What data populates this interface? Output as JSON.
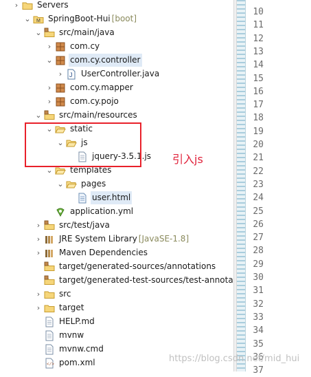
{
  "tree": {
    "items": [
      {
        "label": "Servers",
        "icon": "folder-icon",
        "twisty": "collapsed"
      },
      {
        "label": "SpringBoot-Hui",
        "decoration": "[boot]",
        "icon": "maven-project-icon",
        "twisty": "expanded"
      },
      {
        "label": "src/main/java",
        "icon": "source-folder-icon",
        "twisty": "expanded"
      },
      {
        "label": "com.cy",
        "icon": "package-icon",
        "twisty": "collapsed"
      },
      {
        "label": "com.cy.controller",
        "icon": "package-icon",
        "twisty": "expanded",
        "selected": true
      },
      {
        "label": "UserController.java",
        "icon": "java-file-icon",
        "twisty": "collapsed"
      },
      {
        "label": "com.cy.mapper",
        "icon": "package-icon",
        "twisty": "collapsed"
      },
      {
        "label": "com.cy.pojo",
        "icon": "package-icon",
        "twisty": "collapsed"
      },
      {
        "label": "src/main/resources",
        "icon": "source-folder-icon",
        "twisty": "expanded"
      },
      {
        "label": "static",
        "icon": "folder-open-icon",
        "twisty": "expanded"
      },
      {
        "label": "js",
        "icon": "folder-open-icon",
        "twisty": "expanded"
      },
      {
        "label": "jquery-3.5.1.js",
        "icon": "file-icon",
        "twisty": "none"
      },
      {
        "label": "templates",
        "icon": "folder-open-icon",
        "twisty": "expanded"
      },
      {
        "label": "pages",
        "icon": "folder-open-icon",
        "twisty": "expanded"
      },
      {
        "label": "user.html",
        "icon": "html-file-icon",
        "twisty": "none",
        "selected": true
      },
      {
        "label": "application.yml",
        "icon": "yml-file-icon",
        "twisty": "none"
      },
      {
        "label": "src/test/java",
        "icon": "source-folder-icon",
        "twisty": "collapsed"
      },
      {
        "label": "JRE System Library",
        "decoration": "[JavaSE-1.8]",
        "icon": "library-icon",
        "twisty": "collapsed"
      },
      {
        "label": "Maven Dependencies",
        "icon": "library-icon",
        "twisty": "collapsed"
      },
      {
        "label": "target/generated-sources/annotations",
        "icon": "source-folder-icon",
        "twisty": "none"
      },
      {
        "label": "target/generated-test-sources/test-annotation",
        "icon": "source-folder-icon",
        "twisty": "none"
      },
      {
        "label": "src",
        "icon": "folder-icon",
        "twisty": "collapsed"
      },
      {
        "label": "target",
        "icon": "folder-icon",
        "twisty": "collapsed"
      },
      {
        "label": "HELP.md",
        "icon": "file-icon",
        "twisty": "none"
      },
      {
        "label": "mvnw",
        "icon": "file-icon",
        "twisty": "none"
      },
      {
        "label": "mvnw.cmd",
        "icon": "file-icon",
        "twisty": "none"
      },
      {
        "label": "pom.xml",
        "icon": "xml-file-icon",
        "twisty": "none"
      }
    ]
  },
  "editor": {
    "line_numbers": [
      "10",
      "11",
      "12",
      "13",
      "14",
      "15",
      "16",
      "17",
      "18",
      "19",
      "20",
      "21",
      "22",
      "23",
      "24",
      "25",
      "26",
      "27",
      "28",
      "29",
      "30",
      "31",
      "32",
      "33",
      "34",
      "35",
      "36",
      "37"
    ]
  },
  "annotation": {
    "text": "引入js",
    "color": "#e0213a"
  },
  "watermark": "https://blog.csdn.net/mid_hui",
  "colors": {
    "selection": "#dfeaf6",
    "highlight_box": "#e8202a"
  }
}
